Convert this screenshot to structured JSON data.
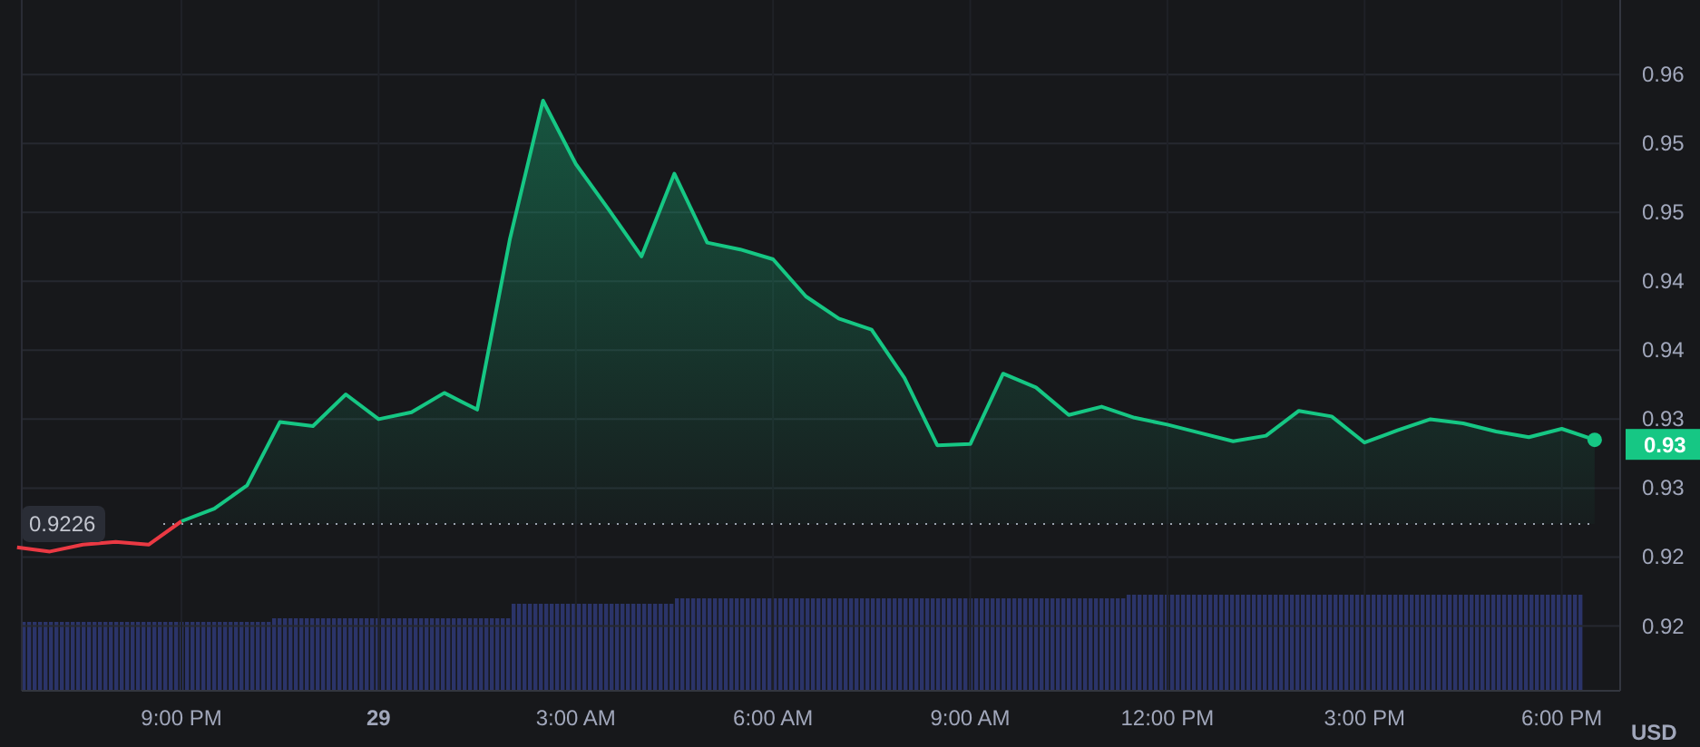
{
  "chart_data": {
    "type": "line",
    "categories": [
      null,
      null,
      null,
      null,
      null,
      "9:00 PM",
      null,
      null,
      null,
      null,
      null,
      "29",
      null,
      null,
      null,
      null,
      null,
      "3:00 AM",
      null,
      null,
      null,
      null,
      null,
      "6:00 AM",
      null,
      null,
      null,
      null,
      null,
      "9:00 AM",
      null,
      null,
      null,
      null,
      null,
      "12:00 PM",
      null,
      null,
      null,
      null,
      null,
      "3:00 PM",
      null,
      null,
      null,
      null,
      null,
      "6:00 PM",
      null
    ],
    "grid": true,
    "series": [
      {
        "color": "#ea3943",
        "values": [
          0.9209,
          0.9206,
          0.9211,
          0.9213,
          0.9211,
          0.9228,
          null,
          null,
          null,
          null,
          null,
          null,
          null,
          null,
          null,
          null,
          null,
          null,
          null,
          null,
          null,
          null,
          null,
          null,
          null,
          null,
          null,
          null,
          null,
          null,
          null,
          null,
          null,
          null,
          null,
          null,
          null,
          null,
          null,
          null,
          null,
          null,
          null,
          null,
          null,
          null,
          null,
          null,
          null
        ]
      },
      {
        "color": "#16c784",
        "values": [
          null,
          null,
          null,
          null,
          null,
          0.9228,
          0.9237,
          0.9254,
          0.93,
          0.9297,
          0.932,
          0.9302,
          0.9307,
          0.9321,
          0.9309,
          0.9433,
          0.9533,
          0.9487,
          0.9454,
          0.942,
          0.948,
          0.943,
          0.9425,
          0.9418,
          0.9391,
          0.9375,
          0.9367,
          0.9332,
          0.9283,
          0.9284,
          0.9335,
          0.9325,
          0.9305,
          0.9311,
          0.9303,
          0.9298,
          0.9292,
          0.9286,
          0.929,
          0.9308,
          0.9304,
          0.9285,
          0.9294,
          0.9302,
          0.9299,
          0.9293,
          0.9289,
          0.9295,
          0.9287
        ]
      }
    ],
    "ylim": [
      0.9105,
      0.9606
    ],
    "yticks": [
      {
        "value": 0.9552,
        "label": "0.96"
      },
      {
        "value": 0.9502,
        "label": "0.95"
      },
      {
        "value": 0.9452,
        "label": "0.95"
      },
      {
        "value": 0.9402,
        "label": "0.94"
      },
      {
        "value": 0.9352,
        "label": "0.94"
      },
      {
        "value": 0.9302,
        "label": "0.93"
      },
      {
        "value": 0.9252,
        "label": "0.93"
      },
      {
        "value": 0.9202,
        "label": "0.92"
      },
      {
        "value": 0.9152,
        "label": "0.92"
      }
    ],
    "ref_lines": [
      {
        "axis": "y",
        "value": 0.9226,
        "label": "0.9226"
      }
    ],
    "ylabel": "USD"
  },
  "current_price": {
    "label": "0.93",
    "color": "#16c784"
  }
}
